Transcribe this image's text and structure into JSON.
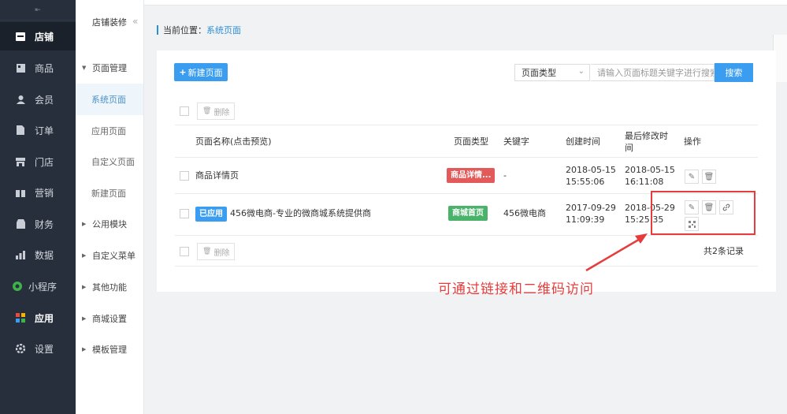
{
  "sidebar": {
    "collapse_glyph": "⇤",
    "items": [
      {
        "label": "店铺",
        "icon": "store-icon"
      },
      {
        "label": "商品",
        "icon": "goods-icon"
      },
      {
        "label": "会员",
        "icon": "member-icon"
      },
      {
        "label": "订单",
        "icon": "order-icon"
      },
      {
        "label": "门店",
        "icon": "shop-icon"
      },
      {
        "label": "营销",
        "icon": "marketing-icon"
      },
      {
        "label": "财务",
        "icon": "finance-icon"
      },
      {
        "label": "数据",
        "icon": "data-icon"
      },
      {
        "label": "小程序",
        "icon": "miniprogram-icon"
      },
      {
        "label": "应用",
        "icon": "apps-icon"
      },
      {
        "label": "设置",
        "icon": "settings-icon"
      }
    ]
  },
  "subnav": {
    "title": "店铺装修",
    "toggle_glyph": "«",
    "items": [
      {
        "label": "页面管理",
        "type": "group",
        "caret": "▼"
      },
      {
        "label": "系统页面",
        "type": "child",
        "active": true
      },
      {
        "label": "应用页面",
        "type": "child"
      },
      {
        "label": "自定义页面",
        "type": "child"
      },
      {
        "label": "新建页面",
        "type": "child"
      },
      {
        "label": "公用模块",
        "type": "group",
        "caret": "▶"
      },
      {
        "label": "自定义菜单",
        "type": "group",
        "caret": "▶"
      },
      {
        "label": "其他功能",
        "type": "group",
        "caret": "▶"
      },
      {
        "label": "商城设置",
        "type": "group",
        "caret": "▶"
      },
      {
        "label": "模板管理",
        "type": "group",
        "caret": "▶"
      }
    ]
  },
  "breadcrumb": {
    "prefix": "当前位置：",
    "current": "系统页面"
  },
  "toolbar": {
    "new_page": "新建页面",
    "page_type_select": "页面类型",
    "search_placeholder": "请输入页面标题关键字进行搜索",
    "search_button": "搜索",
    "delete_button": "删除"
  },
  "table": {
    "headers": {
      "name": "页面名称(点击预览)",
      "type": "页面类型",
      "keyword": "关键字",
      "created": "创建时间",
      "modified_line1": "最后修改时",
      "modified_line2": "间",
      "actions": "操作"
    },
    "rows": [
      {
        "name": "商品详情页",
        "applied_tag": "",
        "type_tag": "商品详情...",
        "keyword": "-",
        "created_date": "2018-05-15",
        "created_time": "15:55:06",
        "modified_date": "2018-05-15",
        "modified_time": "16:11:08"
      },
      {
        "name": "456微电商-专业的微商城系统提供商",
        "applied_tag": "已应用",
        "type_tag": "商城首页",
        "keyword": "456微电商",
        "created_date": "2017-09-29",
        "created_time": "11:09:39",
        "modified_date": "2018-05-29",
        "modified_time": "15:25:35"
      }
    ],
    "total": "共2条记录"
  },
  "annotation": {
    "text": "可通过链接和二维码访问",
    "color": "#e53c3c"
  },
  "colors": {
    "primary": "#3a9df0",
    "sidebar_bg": "#262f3b",
    "tag_red": "#e25a5a",
    "tag_green": "#49b36a"
  }
}
